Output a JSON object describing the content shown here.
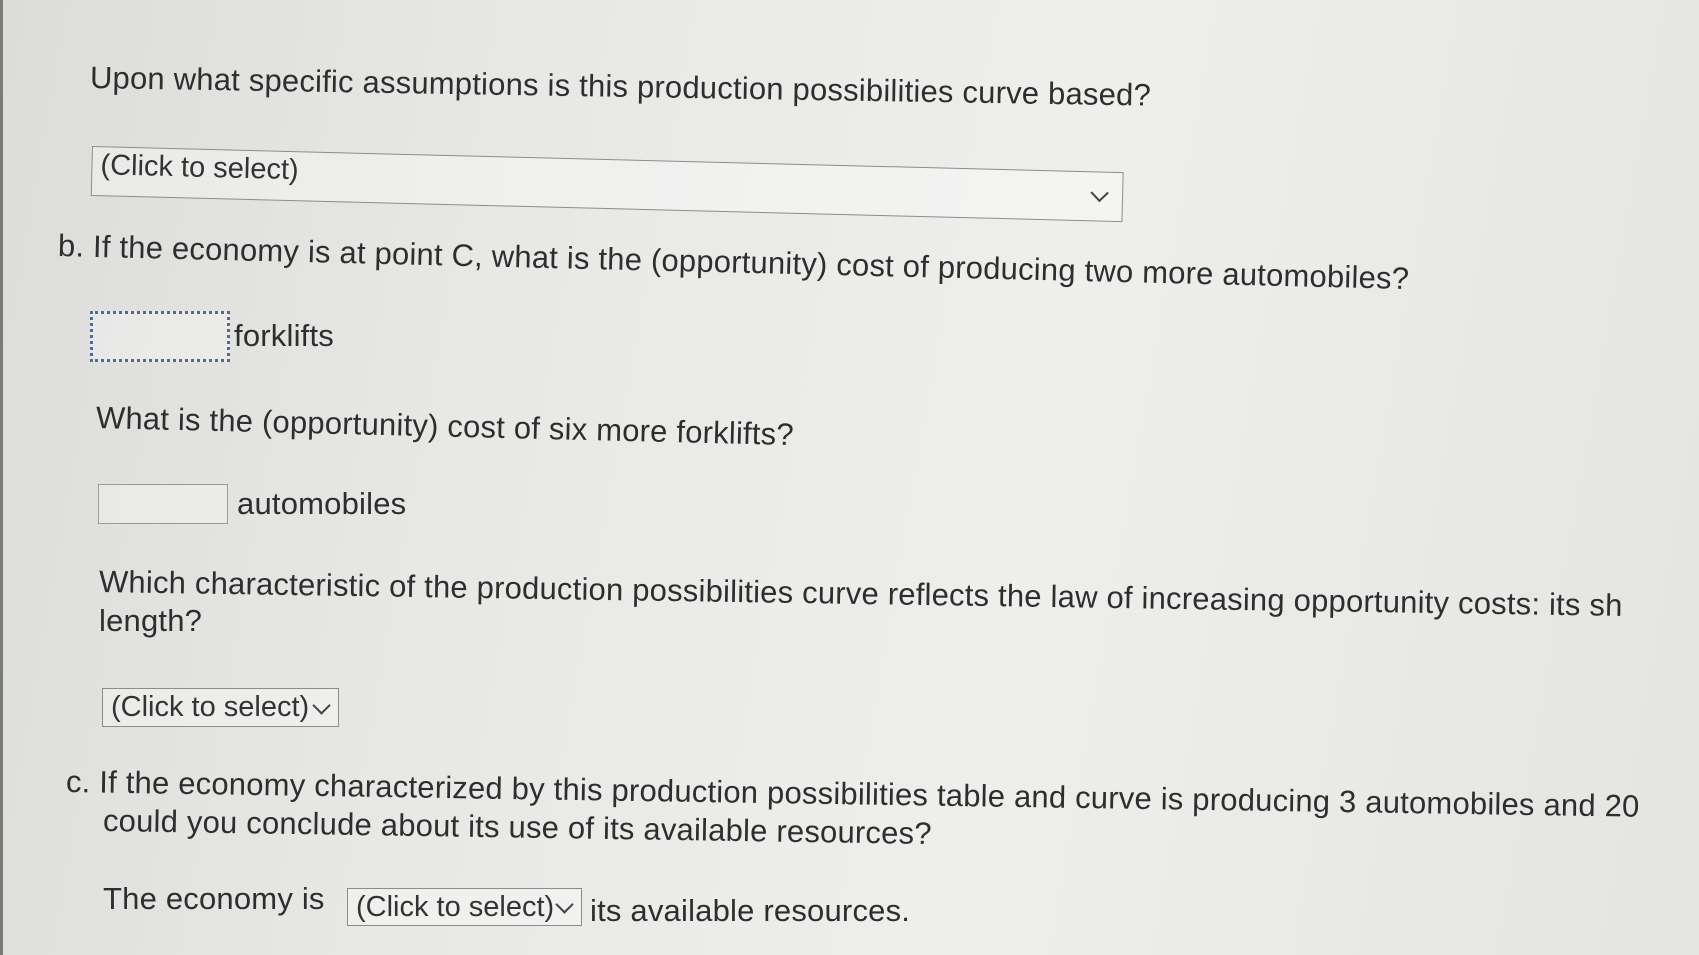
{
  "question_a": {
    "prompt": "Upon what specific assumptions is this production possibilities curve based?",
    "select_label": "(Click to select)"
  },
  "question_b": {
    "prompt": "b. If the economy is at point C, what is the (opportunity) cost of producing two more automobiles?",
    "answer1_value": "",
    "answer1_unit": "forklifts",
    "prompt2": "What is the (opportunity) cost of six more forklifts?",
    "answer2_value": "",
    "answer2_unit": "automobiles",
    "prompt3_line1": "Which characteristic of the production possibilities curve reflects the law of increasing opportunity costs: its sh",
    "prompt3_line2": "length?",
    "select_label": "(Click to select)"
  },
  "question_c": {
    "prompt_line1": "c. If the economy characterized by this production possibilities table and curve is producing 3 automobiles and 20",
    "prompt_line2": "could you conclude about its use of its available resources?",
    "sentence_start": "The economy is",
    "select_label": "(Click to select)",
    "sentence_end": "its available resources."
  }
}
